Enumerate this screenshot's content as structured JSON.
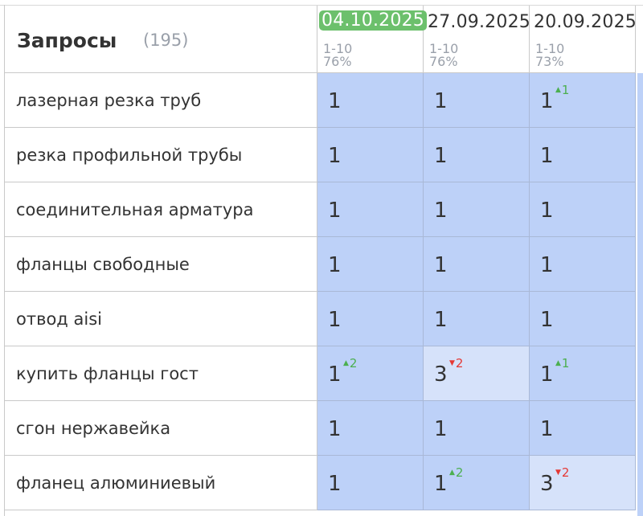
{
  "header": {
    "title": "Запросы",
    "count": "(195)",
    "dates": [
      {
        "label": "04.10.2025",
        "range": "1-10",
        "percent": "76%",
        "active": true
      },
      {
        "label": "27.09.2025",
        "range": "1-10",
        "percent": "76%",
        "active": false
      },
      {
        "label": "20.09.2025",
        "range": "1-10",
        "percent": "73%",
        "active": false
      }
    ]
  },
  "rows": [
    {
      "query": "лазерная резка труб",
      "cells": [
        {
          "value": "1"
        },
        {
          "value": "1"
        },
        {
          "value": "1",
          "delta": "1",
          "dir": "up"
        }
      ]
    },
    {
      "query": "резка профильной трубы",
      "cells": [
        {
          "value": "1"
        },
        {
          "value": "1"
        },
        {
          "value": "1"
        }
      ]
    },
    {
      "query": "соединительная арматура",
      "cells": [
        {
          "value": "1"
        },
        {
          "value": "1"
        },
        {
          "value": "1"
        }
      ]
    },
    {
      "query": "фланцы свободные",
      "cells": [
        {
          "value": "1"
        },
        {
          "value": "1"
        },
        {
          "value": "1"
        }
      ]
    },
    {
      "query": "отвод aisi",
      "cells": [
        {
          "value": "1"
        },
        {
          "value": "1"
        },
        {
          "value": "1"
        }
      ]
    },
    {
      "query": "купить фланцы гост",
      "cells": [
        {
          "value": "1",
          "delta": "2",
          "dir": "up"
        },
        {
          "value": "3",
          "delta": "2",
          "dir": "down",
          "light": true
        },
        {
          "value": "1",
          "delta": "1",
          "dir": "up"
        }
      ]
    },
    {
      "query": "сгон нержавейка",
      "cells": [
        {
          "value": "1"
        },
        {
          "value": "1"
        },
        {
          "value": "1"
        }
      ]
    },
    {
      "query": "фланец алюминиевый",
      "cells": [
        {
          "value": "1"
        },
        {
          "value": "1",
          "delta": "2",
          "dir": "up"
        },
        {
          "value": "3",
          "delta": "2",
          "dir": "down",
          "light": true
        }
      ]
    }
  ],
  "colors": {
    "cell_bg": "#bdd1f8",
    "cell_bg_light": "#d6e2fa",
    "active_date_bg": "#6cc06c",
    "delta_up": "#4caf50",
    "delta_down": "#e53935"
  }
}
